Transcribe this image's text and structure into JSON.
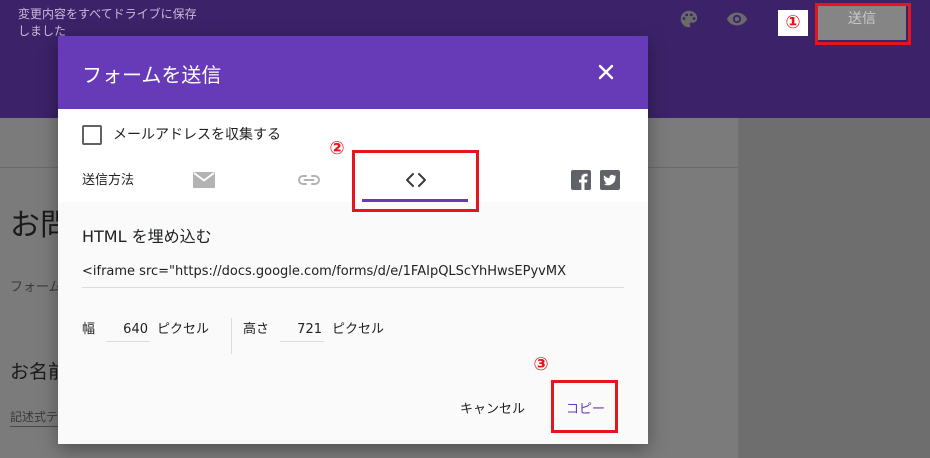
{
  "header": {
    "save_status": "変更内容をすべてドライブに保存しました",
    "send_button": "送信",
    "icons": [
      "palette-icon",
      "eye-icon",
      "more-icon"
    ]
  },
  "form_background": {
    "title": "お問",
    "description": "フォーム",
    "question": "お名前",
    "short_answer_hint": "記述式テ"
  },
  "dialog": {
    "title": "フォームを送信",
    "collect_email_label": "メールアドレスを収集する",
    "collect_email_checked": false,
    "send_via_label": "送信方法",
    "tabs": [
      {
        "name": "email",
        "icon": "mail-icon",
        "selected": false
      },
      {
        "name": "link",
        "icon": "link-icon",
        "selected": false
      },
      {
        "name": "embed",
        "icon": "code-icon",
        "selected": true
      }
    ],
    "social": [
      "facebook-icon",
      "twitter-icon"
    ],
    "embed": {
      "heading": "HTML を埋め込む",
      "code": "<iframe src=\"https://docs.google.com/forms/d/e/1FAIpQLScYhHwsEPyvMX",
      "width_label": "幅",
      "width_value": "640",
      "width_unit": "ピクセル",
      "height_label": "高さ",
      "height_value": "721",
      "height_unit": "ピクセル"
    },
    "cancel_label": "キャンセル",
    "copy_label": "コピー"
  },
  "annotations": {
    "step1": "①",
    "step2": "②",
    "step3": "③",
    "color": "#e8141b"
  },
  "colors": {
    "accent": "#673ab7",
    "header_bg": "#3c2268"
  }
}
